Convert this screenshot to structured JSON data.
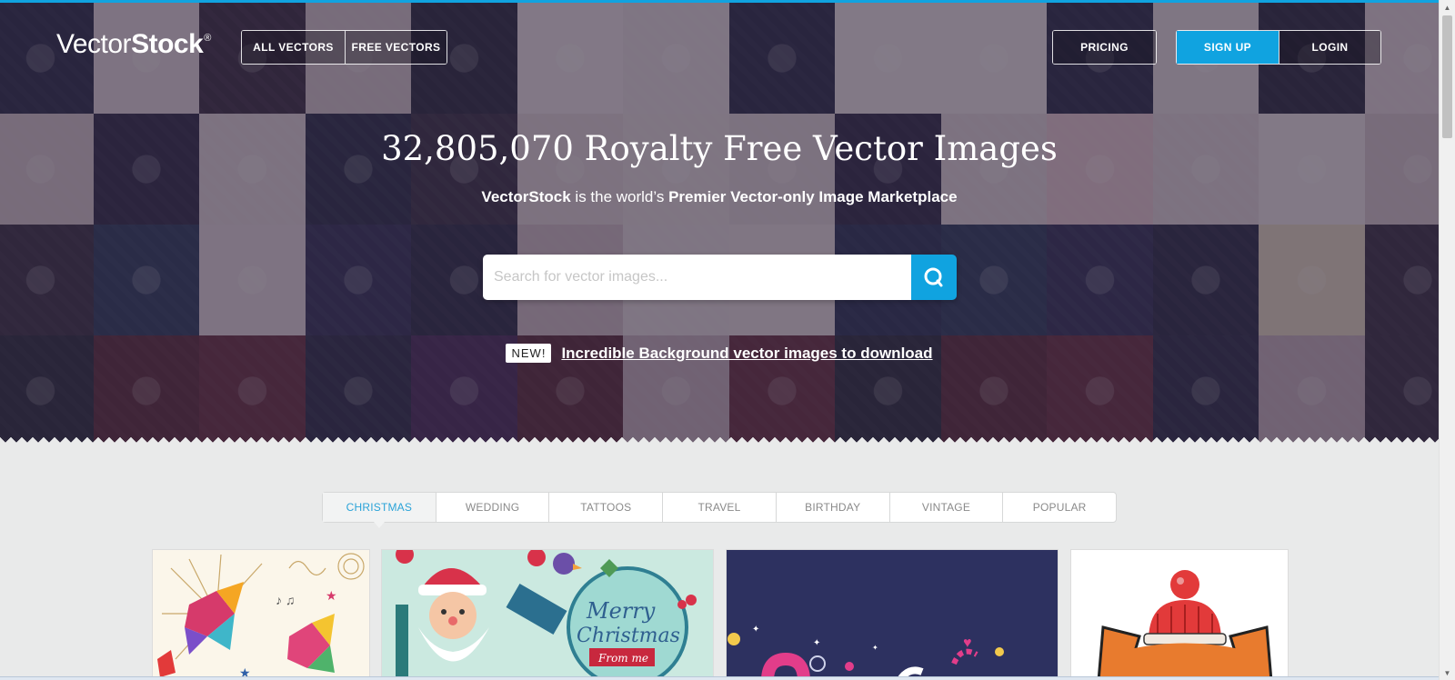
{
  "header": {
    "logo_light": "Vector",
    "logo_bold": "Stock",
    "logo_reg": "®",
    "nav_left": [
      "ALL VECTORS",
      "FREE VECTORS"
    ],
    "pricing": "PRICING",
    "signup": "SIGN UP",
    "login": "LOGIN"
  },
  "hero": {
    "headline": "32,805,070 Royalty Free Vector Images",
    "sub_brand": "VectorStock",
    "sub_middle": " is the world’s ",
    "sub_tail": "Premier Vector-only Image Marketplace",
    "search_placeholder": "Search for vector images...",
    "new_badge": "NEW!",
    "new_link": "Incredible Background vector images to download",
    "tile_colors": [
      "#2b2a4a",
      "#e6d7df",
      "#3b2d44",
      "#d9c8d0",
      "#2a2840",
      "#efe3e8",
      "#e9dce2",
      "#2b2a4a",
      "#efe4e8",
      "#efe4e8",
      "#2b2a4a",
      "#e8dde2",
      "#2a2840",
      "#e6d6de",
      "#d9c7cf",
      "#2f2848",
      "#e4d6dc",
      "#2a2c4a",
      "#3a3048",
      "#e4d5da",
      "#e8dce1",
      "#e3d4da",
      "#2f2848",
      "#e4d6dc",
      "#eccbd5",
      "#e4d6dc",
      "#efe4e8",
      "#d9c7cf",
      "#3a2f46",
      "#2d3a5e",
      "#e6d7df",
      "#33305a",
      "#2c2b48",
      "#d4bfc9",
      "#e9dce2",
      "#eadde3",
      "#2a3258",
      "#2d3a5e",
      "#33305a",
      "#2c2b48",
      "#e9d9c5",
      "#3a2f46",
      "#2b2a3e",
      "#5b2a3c",
      "#6a2f43",
      "#2d2c4a",
      "#4a2b5c",
      "#5b2a3c",
      "#c9b2bf",
      "#6a2f43",
      "#2b2a3e",
      "#5b2a3c",
      "#6a2f43",
      "#2d2c4a",
      "#c9b2bf",
      "#3a2f46"
    ]
  },
  "tabs": [
    "CHRISTMAS",
    "WEDDING",
    "TATTOOS",
    "TRAVEL",
    "BIRTHDAY",
    "VINTAGE",
    "POPULAR"
  ],
  "active_tab": "CHRISTMAS",
  "cards": {
    "card2_line1": "Merry",
    "card2_line2": "Christmas",
    "card2_ribbon": "From me"
  }
}
